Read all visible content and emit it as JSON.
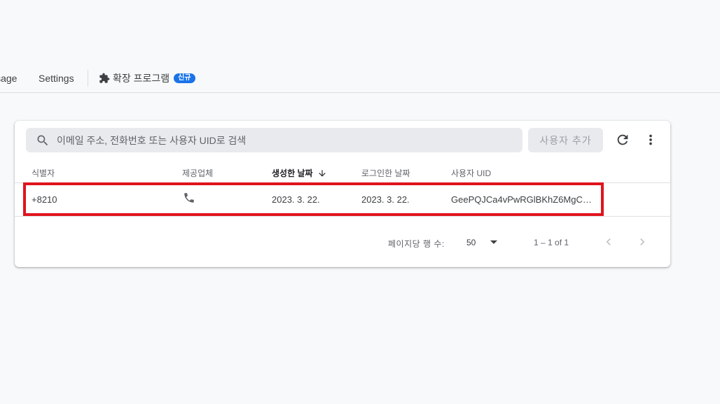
{
  "tabs": {
    "usage": "Usage",
    "settings": "Settings",
    "extensions": "확장 프로그램",
    "extensions_badge": "신규"
  },
  "search": {
    "placeholder": "이메일 주소, 전화번호 또는 사용자 UID로 검색",
    "value": ""
  },
  "toolbar": {
    "add_user_label": "사용자 추가"
  },
  "table": {
    "columns": [
      "식별자",
      "제공업체",
      "생성한 날짜",
      "로그인한 날짜",
      "사용자 UID"
    ],
    "rows": [
      {
        "identifier": "+8210",
        "provider": "phone-icon",
        "created": "2023. 3. 22.",
        "signed_in": "2023. 3. 22.",
        "uid": "GeePQJCa4vPwRGlBKhZ6MgC1u…"
      }
    ]
  },
  "pagination": {
    "rows_per_page_label": "페이지당 행 수:",
    "rows_per_page": "50",
    "range": "1 – 1 of 1"
  },
  "colors": {
    "highlight": "#e0141e",
    "badge": "#1a73e8"
  }
}
